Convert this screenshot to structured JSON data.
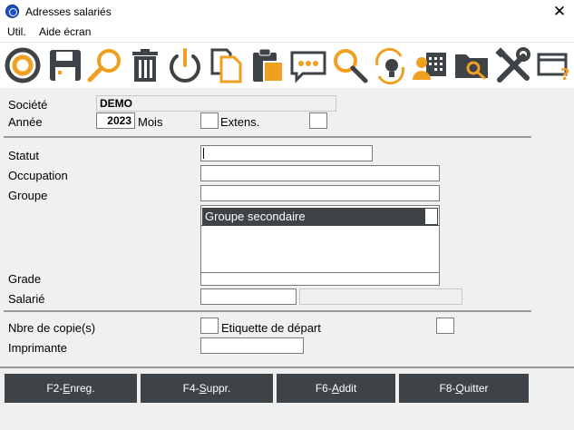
{
  "window": {
    "title": "Adresses salariés",
    "close_glyph": "✕"
  },
  "menu": {
    "items": [
      "Util.",
      "Aide écran"
    ]
  },
  "toolbar": {
    "accent": "#f0a020",
    "dark": "#3d4347",
    "icons": [
      "lifebuoy-icon",
      "save-icon",
      "search-icon",
      "trash-icon",
      "power-icon",
      "copy-icon",
      "paste-icon",
      "chat-icon",
      "find-icon",
      "refresh-idea-icon",
      "contacts-calendar-icon",
      "folder-search-icon",
      "tools-icon",
      "window-help-icon"
    ]
  },
  "header": {
    "societe_label": "Société",
    "societe_value": "DEMO",
    "annee_label": "Année",
    "annee_value": "2023",
    "mois_label": "Mois",
    "extens_label": "Extens."
  },
  "filters": {
    "statut_label": "Statut",
    "occupation_label": "Occupation",
    "groupe_label": "Groupe",
    "groupe_secondaire_header": "Groupe secondaire",
    "grade_label": "Grade",
    "salarie_label": "Salarié"
  },
  "print": {
    "copies_label": "Nbre de copie(s)",
    "etiquette_label": "Etiquette de départ",
    "imprimante_label": "Imprimante"
  },
  "buttons": {
    "f2": {
      "prefix": "F2-",
      "key": "E",
      "rest": "nreg."
    },
    "f4": {
      "prefix": "F4-",
      "key": "S",
      "rest": "uppr."
    },
    "f6": {
      "prefix": "F6-",
      "key": "A",
      "rest": "ddit"
    },
    "f8": {
      "prefix": "F8-",
      "key": "Q",
      "rest": "uitter"
    }
  }
}
